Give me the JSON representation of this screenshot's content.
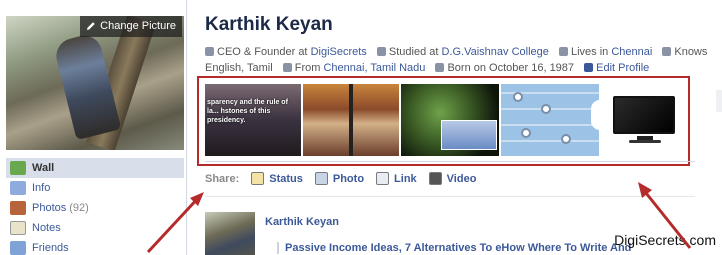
{
  "profile": {
    "change_picture_label": "Change Picture",
    "name": "Karthik Keyan"
  },
  "sidebar": {
    "items": [
      {
        "label": "Wall",
        "active": true,
        "icon": "wall-icon"
      },
      {
        "label": "Info",
        "active": false,
        "icon": "info-icon"
      },
      {
        "label": "Photos",
        "count": "(92)",
        "active": false,
        "icon": "photos-icon"
      },
      {
        "label": "Notes",
        "active": false,
        "icon": "notes-icon"
      },
      {
        "label": "Friends",
        "active": false,
        "icon": "friends-icon"
      }
    ]
  },
  "info": {
    "work_prefix": "CEO & Founder at",
    "work_company": "DigiSecrets",
    "studied_prefix": "Studied at",
    "studied_school": "D.G.Vaishnav College",
    "lives_prefix": "Lives in",
    "lives_city": "Chennai",
    "knows_prefix": "Knows",
    "languages": "English, Tamil",
    "from_prefix": "From",
    "from_place": "Chennai, Tamil Nadu",
    "born": "Born on October 16, 1987",
    "edit_profile": "Edit Profile"
  },
  "photo_strip": {
    "photo1_text": "sparency and the rule of la... hstones of this presidency."
  },
  "share": {
    "label": "Share:",
    "items": [
      {
        "label": "Status",
        "icon": "status-icon"
      },
      {
        "label": "Photo",
        "icon": "photo-icon"
      },
      {
        "label": "Link",
        "icon": "link-icon"
      },
      {
        "label": "Video",
        "icon": "video-icon"
      }
    ]
  },
  "post": {
    "author": "Karthik Keyan",
    "title": "Passive Income Ideas, 7 Alternatives To eHow Where To Write And"
  },
  "watermark": "DigiSecrets.com",
  "colors": {
    "brand_blue": "#3b5998",
    "highlight_red": "#b52a2a",
    "active_nav_bg": "#d8dfea"
  }
}
